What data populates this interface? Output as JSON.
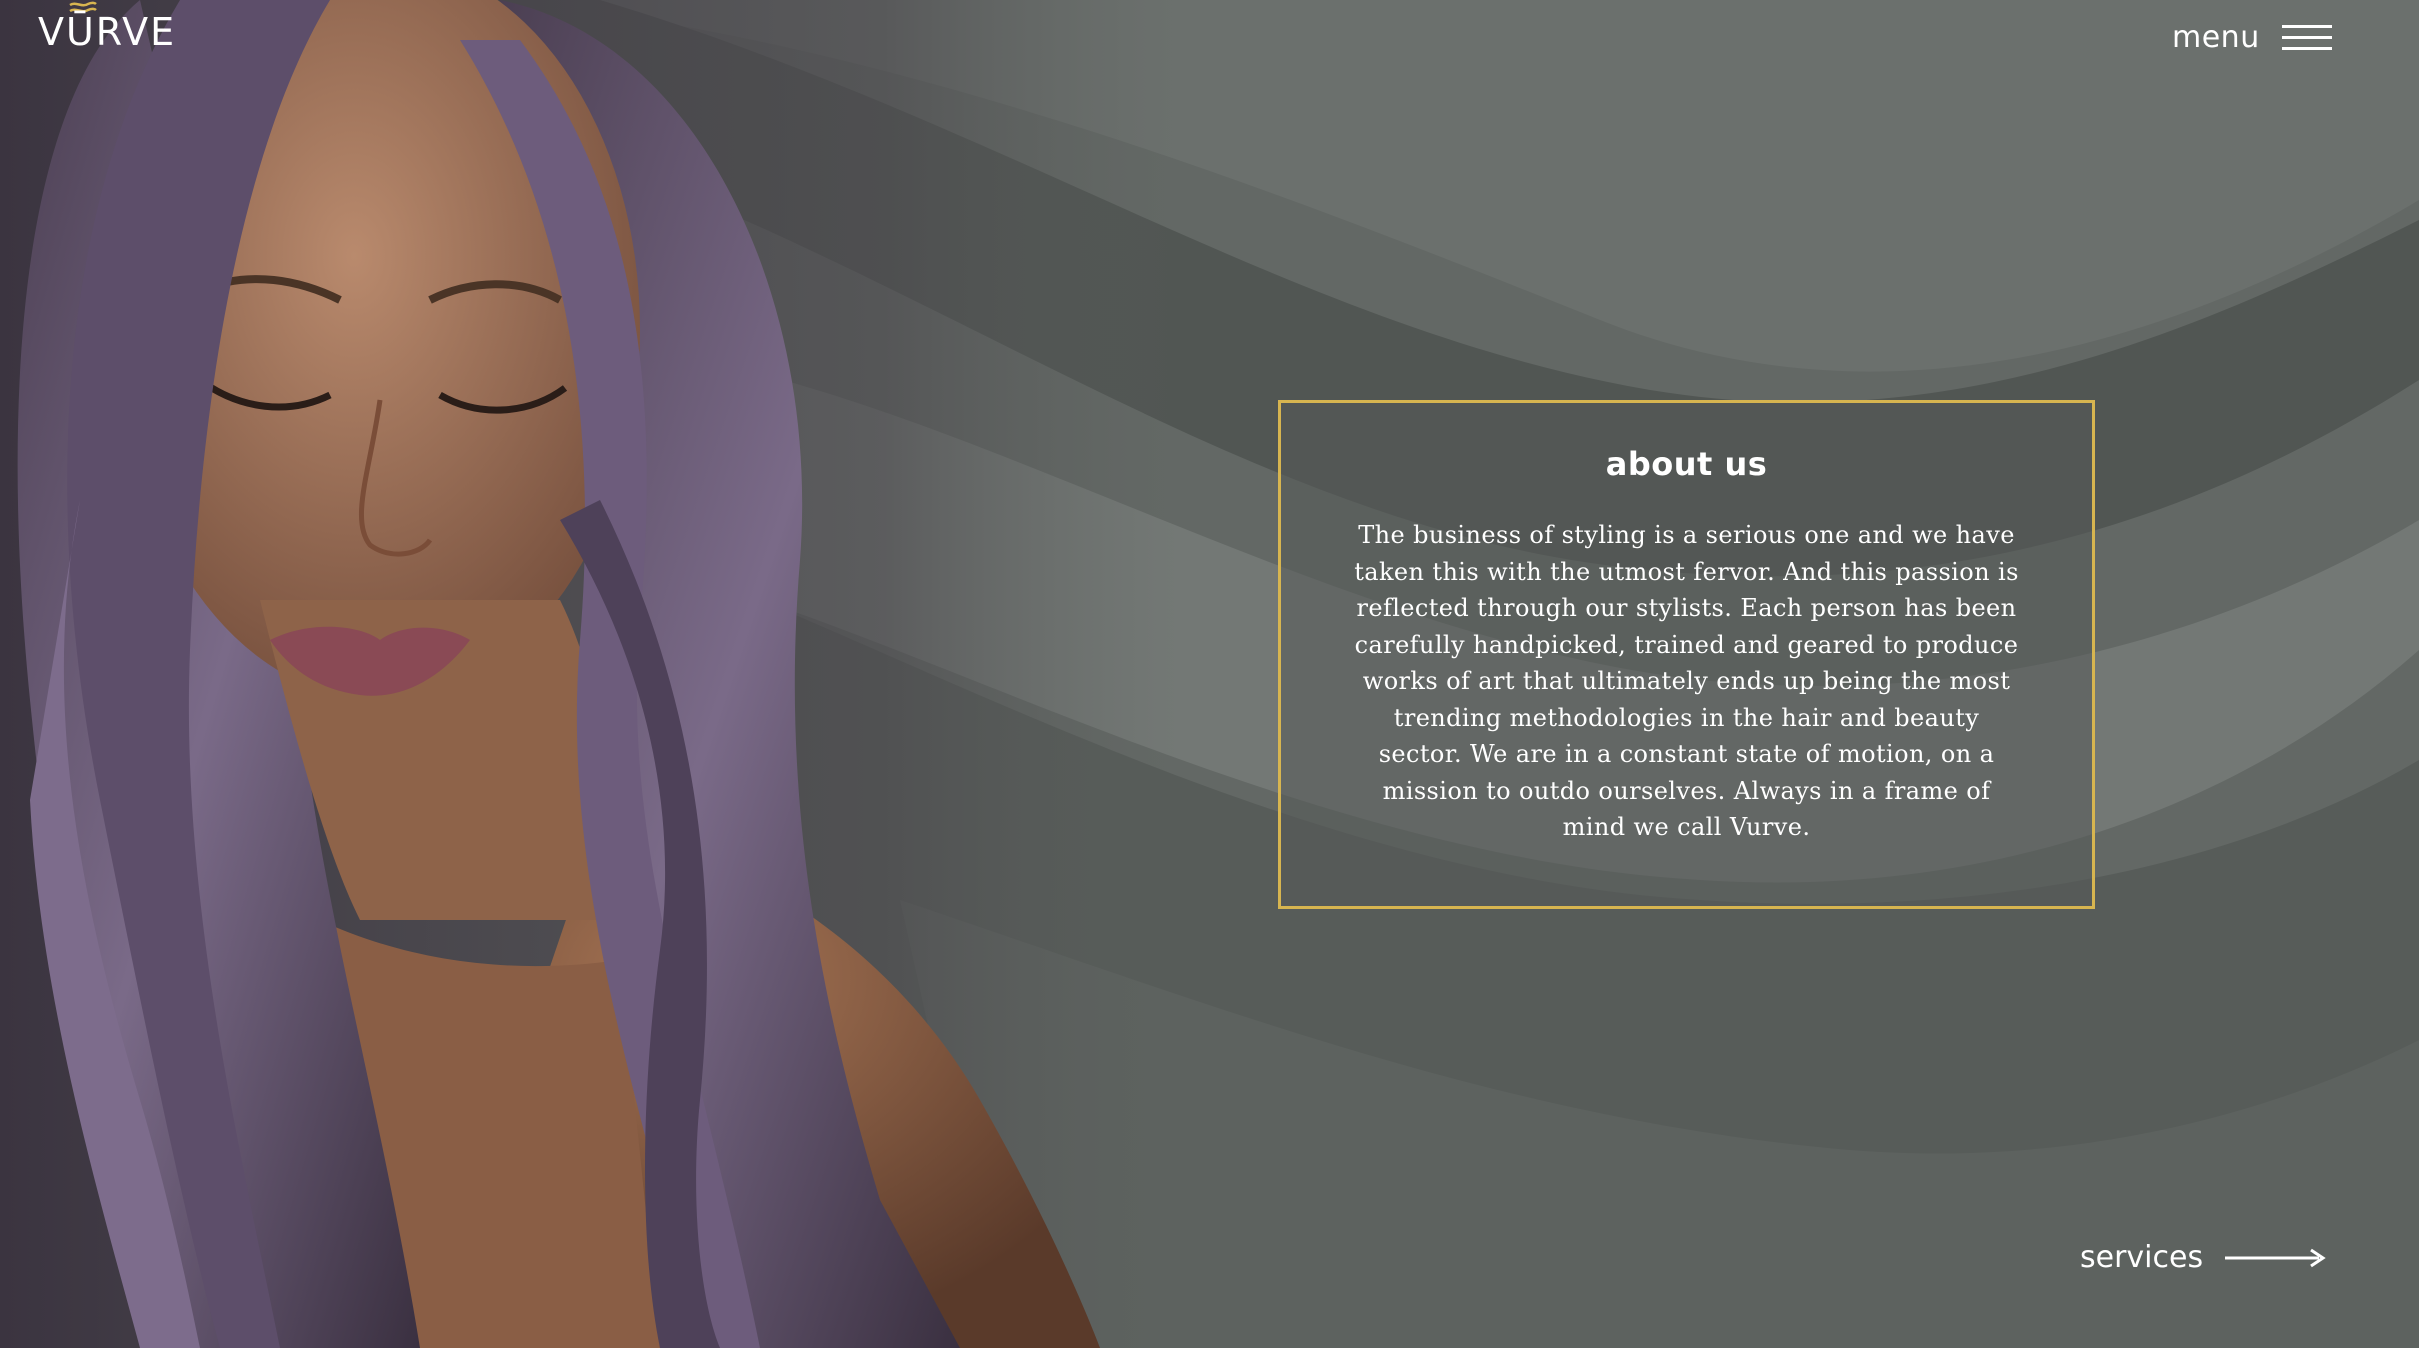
{
  "brand": {
    "logo_text": "VŪRVE"
  },
  "header": {
    "menu_label": "menu"
  },
  "about": {
    "title": "about us",
    "body": "The business of styling is a serious one and we have taken this with the utmost fervor. And this passion is reflected through our stylists. Each person has been carefully handpicked, trained and geared to produce works of art that ultimately ends up being the most trending methodologies in the hair and beauty sector. We are in a constant state of motion, on a mission to outdo ourselves. Always in a frame of mind we call Vurve."
  },
  "footer_nav": {
    "next_label": "services"
  },
  "icons": {
    "menu": "hamburger-icon",
    "next": "arrow-right-icon",
    "logo_mark": "wave-swirl-icon"
  },
  "colors": {
    "accent_gold": "#d7b550",
    "background": "#5c605d",
    "text": "#ffffff",
    "hair": "#6a5578"
  }
}
